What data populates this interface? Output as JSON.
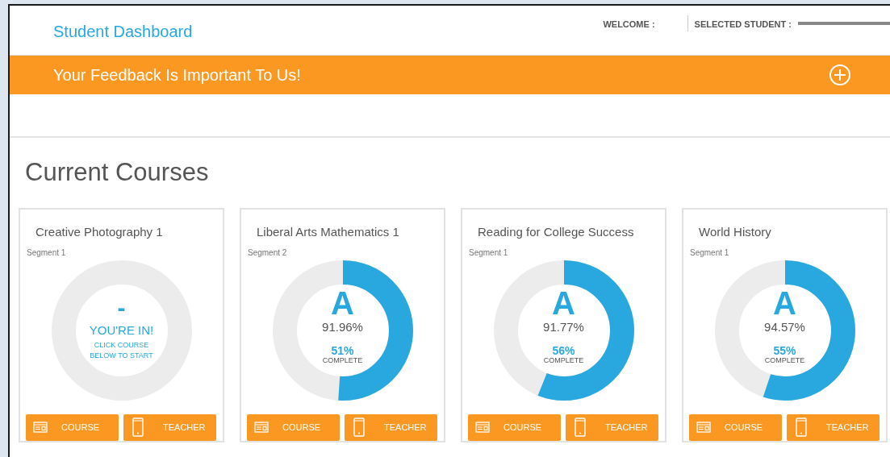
{
  "header": {
    "title": "Student Dashboard",
    "welcome_label": "WELCOME :",
    "selected_student_label": "SELECTED STUDENT :"
  },
  "feedback_banner": {
    "text": "Your Feedback Is Important To Us!"
  },
  "section_title": "Current Courses",
  "courses": [
    {
      "kind": "new",
      "name": "Creative Photography 1",
      "segment": "Segment 1",
      "mark": "-",
      "headline": "YOU'RE IN!",
      "message": "CLICK COURSE BELOW TO START",
      "buttons": [
        "COURSE",
        "TEACHER"
      ]
    },
    {
      "kind": "graded",
      "name": "Liberal Arts Mathematics 1",
      "segment": "Segment 2",
      "grade": "A",
      "score": "91.96%",
      "percent": "51%",
      "complete_label": "COMPLETE",
      "buttons": [
        "COURSE",
        "TEACHER"
      ]
    },
    {
      "kind": "graded",
      "name": "Reading for College Success",
      "segment": "Segment 1",
      "grade": "A",
      "score": "91.77%",
      "percent": "56%",
      "complete_label": "COMPLETE",
      "buttons": [
        "COURSE",
        "TEACHER"
      ]
    },
    {
      "kind": "graded",
      "name": "World History",
      "segment": "Segment 1",
      "grade": "A",
      "score": "94.57%",
      "percent": "55%",
      "complete_label": "COMPLETE",
      "buttons": [
        "COURSE",
        "TEACHER"
      ]
    }
  ]
}
